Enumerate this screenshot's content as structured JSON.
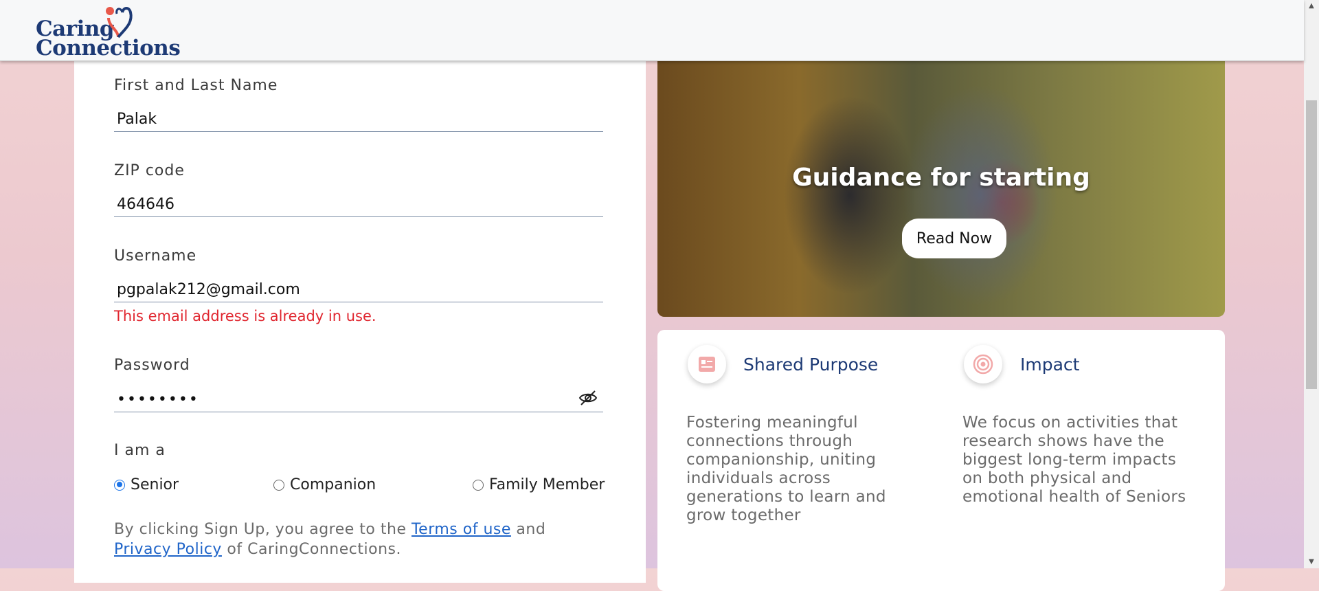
{
  "brand": {
    "logo_line1": "Caring",
    "logo_line2": "Connections"
  },
  "form": {
    "name_label": "First and Last Name",
    "name_value": "Palak",
    "zip_label": "ZIP code",
    "zip_value": "464646",
    "username_label": "Username",
    "username_value": "pgpalak212@gmail.com",
    "username_error": "This email address is already in use.",
    "password_label": "Password",
    "password_value": "••••••••",
    "role_label": "I am a",
    "roles": [
      {
        "label": "Senior",
        "checked": true
      },
      {
        "label": "Companion",
        "checked": false
      },
      {
        "label": "Family Member",
        "checked": false
      }
    ],
    "terms_prefix": "By clicking Sign Up, you agree to the ",
    "terms_link": "Terms of use",
    "terms_mid": " and",
    "privacy_link": "Privacy Policy",
    "terms_suffix": " of CaringConnections."
  },
  "hero": {
    "title": "Guidance for starting",
    "button": "Read Now"
  },
  "features": [
    {
      "icon": "profile-card-icon",
      "title": "Shared Purpose",
      "desc": "Fostering meaningful connections through companionship, uniting individuals across generations to learn and grow together"
    },
    {
      "icon": "target-icon",
      "title": "Impact",
      "desc": "We focus on activities that research shows have the biggest long-term impacts on both physical and emotional health of Seniors"
    }
  ],
  "colors": {
    "brand_navy": "#1d3a75",
    "error": "#e0262f",
    "link": "#1f64c8",
    "accent_pink": "#e98a8a"
  }
}
